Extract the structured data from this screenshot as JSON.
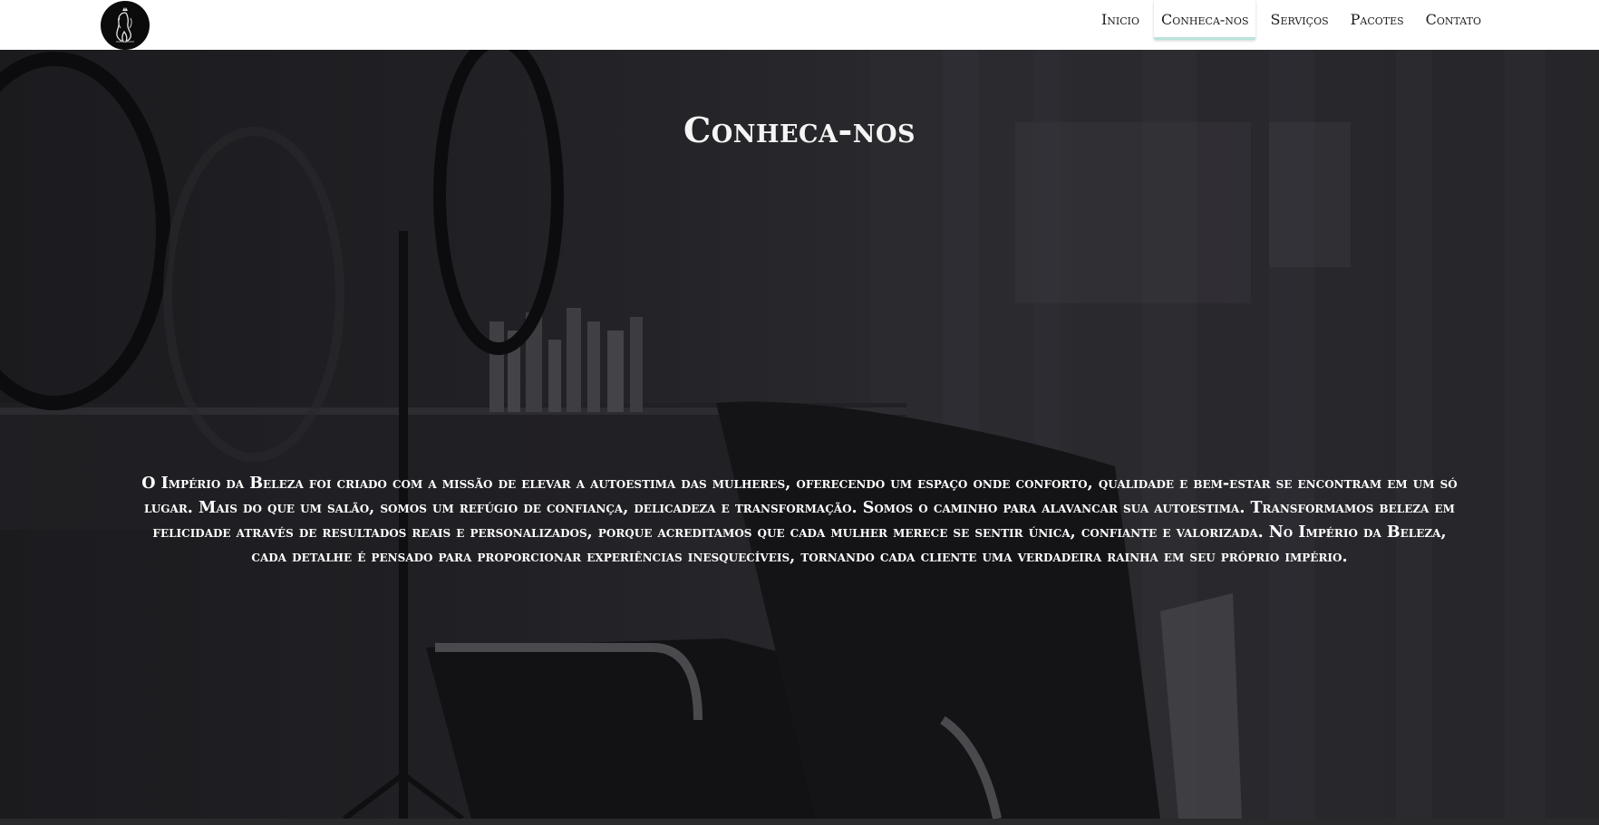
{
  "header": {
    "logo_icon": "crowned-woman-silhouette-logo",
    "nav": [
      {
        "label": "Inicio",
        "active": false
      },
      {
        "label": "Conheca-nos",
        "active": true
      },
      {
        "label": "Serviços",
        "active": false
      },
      {
        "label": "Pacotes",
        "active": false
      },
      {
        "label": "Contato",
        "active": false
      }
    ]
  },
  "hero": {
    "title": "Conheca-nos",
    "text": "O Império da Beleza foi criado com a missão de elevar a autoestima das mulheres, oferecendo um espaço onde conforto, qualidade e bem-estar se encontram em um só lugar. Mais do que um salão, somos um refúgio de confiança, delicadeza e transformação. Somos o caminho para alavancar sua autoestima. Transformamos beleza em felicidade através de resultados reais e personalizados, porque acreditamos que cada mulher merece se sentir única, confiante e valorizada. No Império da Beleza, cada detalhe é pensado para proporcionar experiências inesquecíveis, tornando cada cliente uma verdadeira rainha em seu próprio império.",
    "background": "salon-interior-photo"
  },
  "colors": {
    "nav_active_underline": "#b9e3dc",
    "header_bg": "#ffffff",
    "hero_text": "#ffffff"
  }
}
